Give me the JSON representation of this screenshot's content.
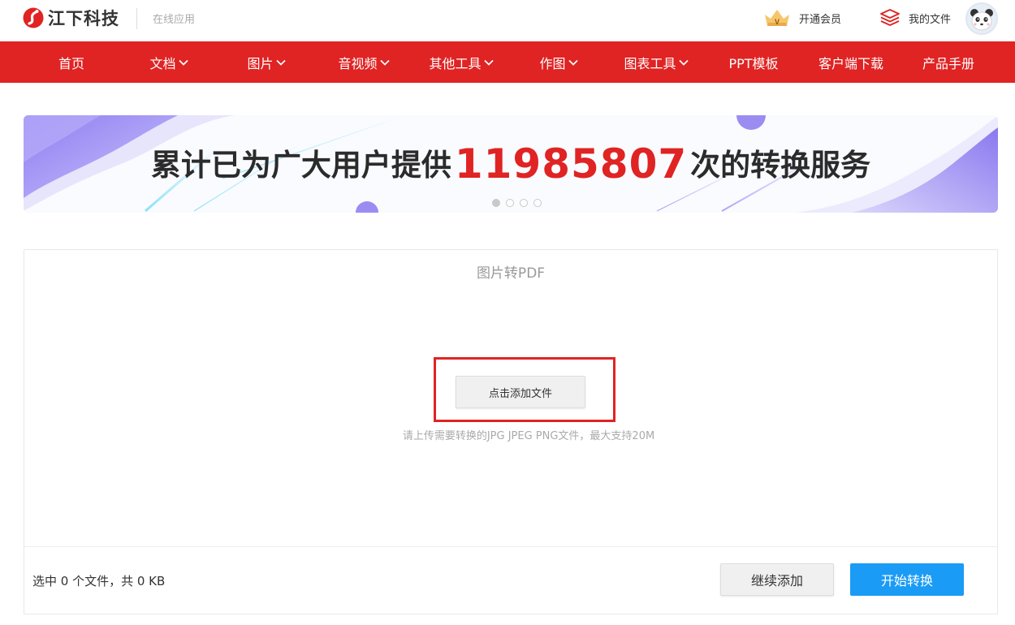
{
  "header": {
    "brand_name": "江下科技",
    "brand_sub": "在线应用",
    "vip_label": "开通会员",
    "files_label": "我的文件",
    "avatar_icon": "panda-avatar-icon"
  },
  "nav": {
    "items": [
      {
        "label": "首页",
        "has_dropdown": false
      },
      {
        "label": "文档",
        "has_dropdown": true
      },
      {
        "label": "图片",
        "has_dropdown": true
      },
      {
        "label": "音视频",
        "has_dropdown": true
      },
      {
        "label": "其他工具",
        "has_dropdown": true
      },
      {
        "label": "作图",
        "has_dropdown": true
      },
      {
        "label": "图表工具",
        "has_dropdown": true
      },
      {
        "label": "PPT模板",
        "has_dropdown": false
      },
      {
        "label": "客户端下载",
        "has_dropdown": false
      },
      {
        "label": "产品手册",
        "has_dropdown": false
      }
    ],
    "bg_color": "#e02323"
  },
  "banner": {
    "text_before": "累计已为广大用户提供",
    "count": "11985807",
    "text_after": "次的转换服务",
    "slides": 4,
    "active_slide": 1
  },
  "converter": {
    "title": "图片转PDF",
    "add_file_label": "点击添加文件",
    "hint": "请上传需要转换的JPG JPEG PNG文件，最大支持20M",
    "file_status": "选中 0 个文件，共 0 KB",
    "continue_label": "继续添加",
    "start_label": "开始转换",
    "accent_color": "#1a9bf5"
  }
}
